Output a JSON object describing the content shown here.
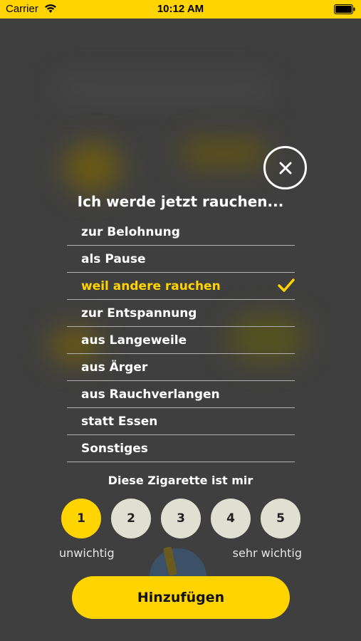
{
  "status_bar": {
    "carrier": "Carrier",
    "time": "10:12 AM",
    "wifi_icon": "wifi-icon",
    "battery_icon": "battery-icon"
  },
  "modal": {
    "title": "Ich werde jetzt rauchen...",
    "close_icon": "close-icon",
    "reasons": [
      {
        "label": "zur Belohnung",
        "selected": false
      },
      {
        "label": "als Pause",
        "selected": false
      },
      {
        "label": "weil andere rauchen",
        "selected": true
      },
      {
        "label": "zur Entspannung",
        "selected": false
      },
      {
        "label": "aus Langeweile",
        "selected": false
      },
      {
        "label": "aus Ärger",
        "selected": false
      },
      {
        "label": "aus Rauchverlangen",
        "selected": false
      },
      {
        "label": "statt Essen",
        "selected": false
      },
      {
        "label": "Sonstiges",
        "selected": false
      }
    ],
    "importance": {
      "label": "Diese Zigarette ist mir",
      "options": [
        "1",
        "2",
        "3",
        "4",
        "5"
      ],
      "selected": "1",
      "min_label": "unwichtig",
      "max_label": "sehr wichtig"
    },
    "submit_label": "Hinzufügen"
  },
  "colors": {
    "accent": "#ffd400",
    "overlay": "#3f3f3f",
    "divider": "#b0b0b0",
    "rating_inactive": "#e0e0d2"
  }
}
